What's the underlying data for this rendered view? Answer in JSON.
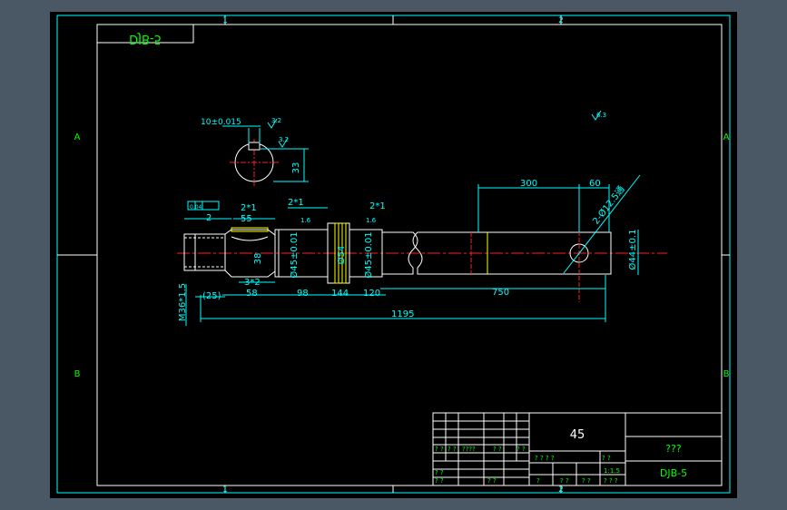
{
  "colors": {
    "frame": "#00ffff",
    "part": "#ffffff",
    "dimension": "#00ffff",
    "centerline": "#ff2020",
    "hatch": "#ffff00",
    "title_text": "#00ff00",
    "background": "#000000",
    "outer": "#4a5866"
  },
  "drawing": {
    "drawing_number_mirrored": "DJB-5",
    "zone_columns": [
      "1",
      "2"
    ],
    "zone_rows": [
      "A",
      "B"
    ],
    "keyway_section": {
      "width_tol": "10±0.015",
      "depth": "33",
      "roughness_1": "3.2",
      "roughness_2": "3.2"
    },
    "general_roughness": "6.3",
    "dimensions": {
      "left_chamfer_tol": "0.04",
      "left_step": "2",
      "chamfer_a": "2*1",
      "len_55": "55",
      "chamfer_b": "2*1",
      "chamfer_c": "2*1",
      "roughness_a": "1.6",
      "roughness_b": "1.6",
      "dia_38": "38",
      "dia_45_a": "Ø45±0.01",
      "dia_54": "Ø54",
      "dia_45_b": "Ø45±0.01",
      "thread": "M36*1.5",
      "groove": "3*2",
      "len_25": "(25)",
      "len_58": "58",
      "len_98": "98",
      "len_144": "144",
      "len_120": "120",
      "len_300": "300",
      "len_60": "60",
      "holes": "2-Ø12.5通",
      "dia_44": "Ø44±0.1",
      "len_750": "750",
      "len_1195": "1195"
    }
  },
  "title_block": {
    "material": "45",
    "part_name": "???",
    "drawing_number": "DJB-5",
    "scale": "1:1.5",
    "cell_q": "?",
    "cell_qq": "? ?",
    "cell_qqqq": "????",
    "cell_q4s": "? ? ? ?",
    "cell_q3s": "? ? ?"
  }
}
